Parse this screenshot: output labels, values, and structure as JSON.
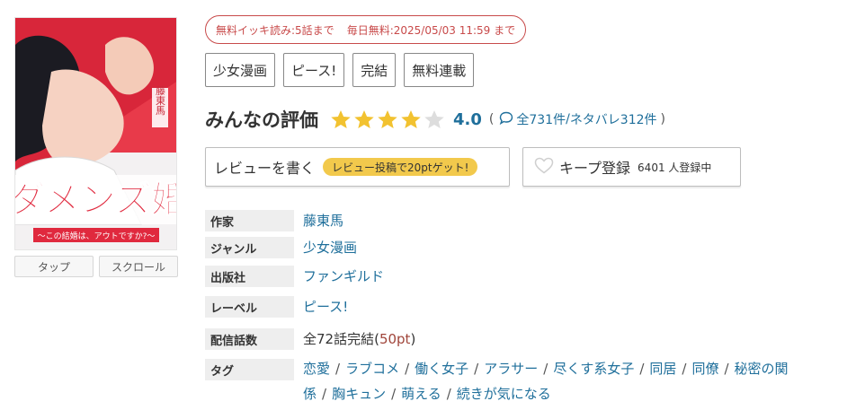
{
  "cover": {
    "title_text": "ダメンズ婚",
    "subtitle_text": "〜この結婚は、アウトですか?〜",
    "author_text": "藤東馬"
  },
  "view_buttons": [
    "タップ",
    "スクロール"
  ],
  "promo": {
    "free_read": "無料イッキ読み:5話まで",
    "daily_free": "毎日無料:2025/05/03 11:59 まで",
    "color": "#c84a4a"
  },
  "genre_tags": [
    "少女漫画",
    "ピース!",
    "完結",
    "無料連載"
  ],
  "rating": {
    "title": "みんなの評価",
    "stars": 4,
    "max_stars": 5,
    "score": "4.0",
    "open_paren": "(",
    "total_reviews": "全731件",
    "slash": "/",
    "spoiler_reviews": "ネタバレ312件",
    "close_paren": ")",
    "star_color": "#f2c230",
    "link_color": "#1f6f9b"
  },
  "actions": {
    "review_label": "レビューを書く",
    "review_bonus": "レビュー投稿で20ptゲット!",
    "keep_label": "キープ登録",
    "keep_count": "6401 人登録中"
  },
  "info": {
    "author_label": "作家",
    "author_value": "藤東馬",
    "genre_label": "ジャンル",
    "genre_value": "少女漫画",
    "publisher_label": "出版社",
    "publisher_value": "ファンギルド",
    "label_label": "レーベル",
    "label_value": "ピース!",
    "episodes_label": "配信話数",
    "episodes_value": "全72話完結(",
    "episodes_pt": "50pt",
    "episodes_close": ")",
    "tags_label": "タグ",
    "tags_separator": "/",
    "tags": [
      "恋愛",
      "ラブコメ",
      "働く女子",
      "アラサー",
      "尽くす系女子",
      "同居",
      "同僚",
      "秘密の関係",
      "胸キュン",
      "萌える",
      "続きが気になる"
    ]
  }
}
